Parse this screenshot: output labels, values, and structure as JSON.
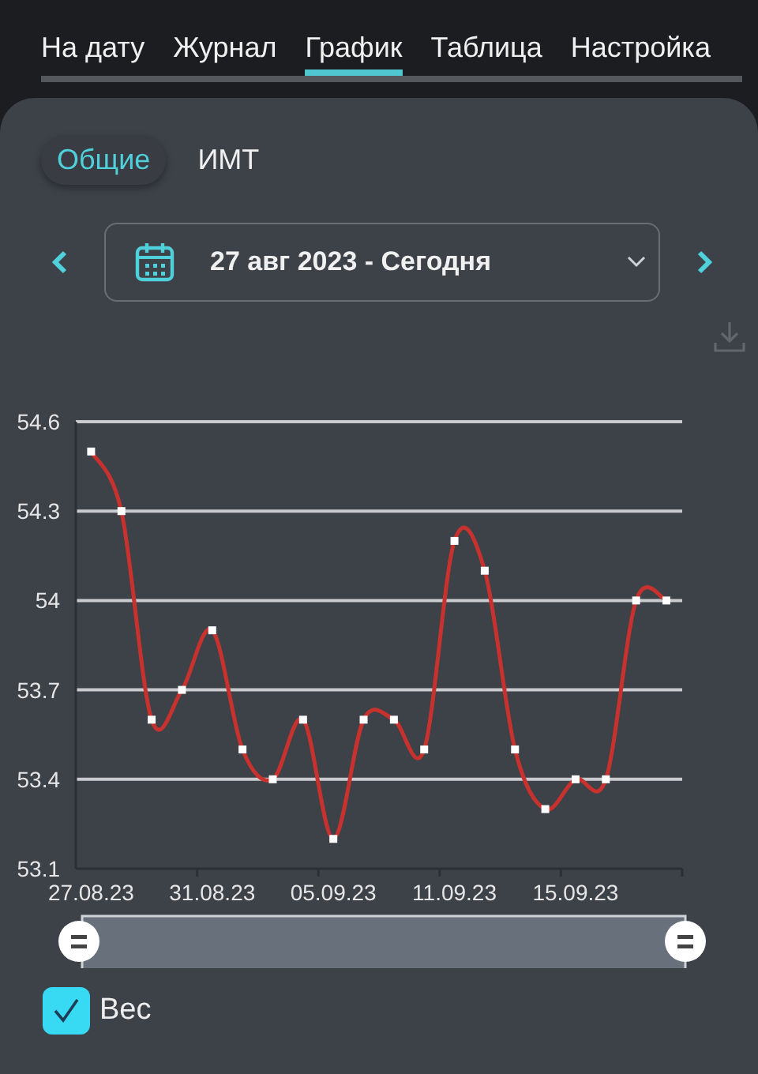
{
  "tabs": [
    {
      "label": "На дату",
      "selected": false
    },
    {
      "label": "Журнал",
      "selected": false
    },
    {
      "label": "График",
      "selected": true
    },
    {
      "label": "Таблица",
      "selected": false
    },
    {
      "label": "Настройка",
      "selected": false
    }
  ],
  "segments": [
    {
      "label": "Общие",
      "selected": true
    },
    {
      "label": "ИМТ",
      "selected": false
    }
  ],
  "date_range": {
    "value": "27 авг 2023 - Сегодня"
  },
  "chart": {
    "chart_data": {
      "type": "line",
      "categories": [
        "27.08.23",
        null,
        null,
        null,
        "31.08.23",
        null,
        null,
        null,
        "05.09.23",
        null,
        null,
        null,
        "11.09.23",
        null,
        null,
        null,
        "15.09.23",
        null,
        null,
        null
      ],
      "series": [
        {
          "name": "Вес",
          "color": "#c8322e",
          "marker": "square",
          "values": [
            54.5,
            54.3,
            53.6,
            53.7,
            53.9,
            53.5,
            53.4,
            53.6,
            53.2,
            53.6,
            53.6,
            53.5,
            54.2,
            54.1,
            53.5,
            53.3,
            53.4,
            53.4,
            54.0,
            54.0
          ]
        }
      ],
      "grid": true,
      "ylim": [
        53.1,
        54.6
      ],
      "yticks": [
        53.1,
        53.4,
        53.7,
        {
          "value": 54.0,
          "label": "54"
        },
        54.3,
        54.6
      ]
    }
  },
  "legend": [
    {
      "checked": true
    }
  ]
}
